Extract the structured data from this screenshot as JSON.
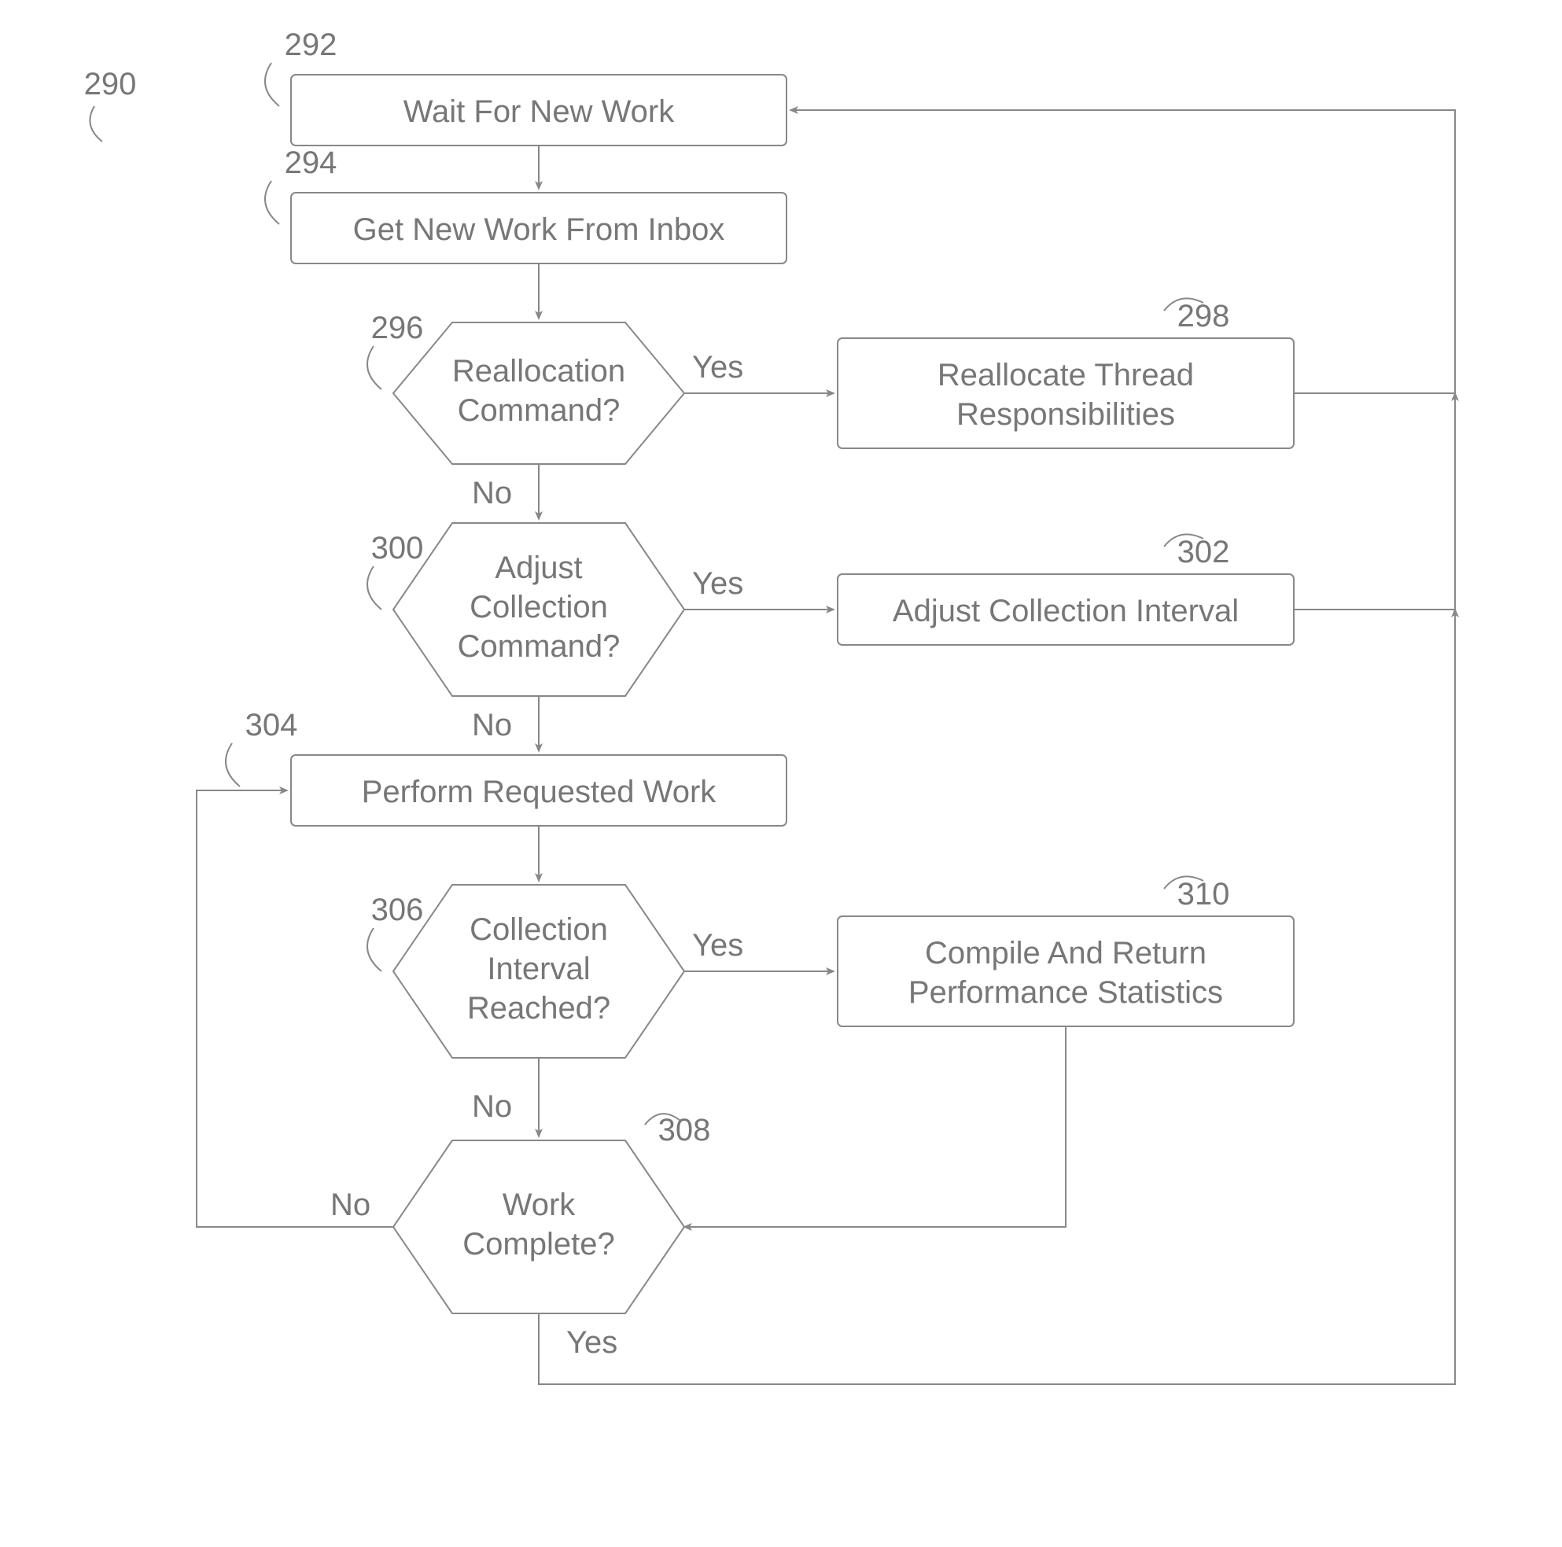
{
  "diagram_ref": "290",
  "nodes": {
    "n292": {
      "ref": "292",
      "text": "Wait For New Work"
    },
    "n294": {
      "ref": "294",
      "text": "Get New Work From Inbox"
    },
    "n296": {
      "ref": "296",
      "text1": "Reallocation",
      "text2": "Command?"
    },
    "n298": {
      "ref": "298",
      "text1": "Reallocate Thread",
      "text2": "Responsibilities"
    },
    "n300": {
      "ref": "300",
      "text1": "Adjust",
      "text2": "Collection",
      "text3": "Command?"
    },
    "n302": {
      "ref": "302",
      "text": "Adjust Collection Interval"
    },
    "n304": {
      "ref": "304",
      "text": "Perform Requested Work"
    },
    "n306": {
      "ref": "306",
      "text1": "Collection",
      "text2": "Interval",
      "text3": "Reached?"
    },
    "n308": {
      "ref": "308",
      "text1": "Work",
      "text2": "Complete?"
    },
    "n310": {
      "ref": "310",
      "text1": "Compile And Return",
      "text2": "Performance Statistics"
    }
  },
  "labels": {
    "yes": "Yes",
    "no": "No"
  }
}
